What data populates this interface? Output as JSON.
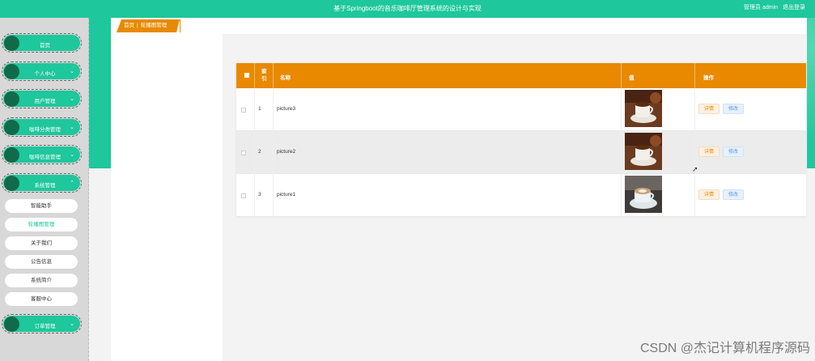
{
  "header": {
    "title": "基于Springboot的音乐咖啡厅管理系统的设计与实现",
    "role": "管理员 admin",
    "logout": "退出登录"
  },
  "sidebar": {
    "menus": [
      {
        "label": "首页",
        "expandable": false
      },
      {
        "label": "个人中心",
        "expandable": true
      },
      {
        "label": "用户管理",
        "expandable": true
      },
      {
        "label": "咖啡分类管理",
        "expandable": true
      },
      {
        "label": "咖啡信息管理",
        "expandable": true
      },
      {
        "label": "系统管理",
        "expandable": true
      },
      {
        "label": "订单管理",
        "expandable": true
      }
    ],
    "sub_items": [
      {
        "label": "智能助手"
      },
      {
        "label": "轮播图管理",
        "active": true
      },
      {
        "label": "关于我们"
      },
      {
        "label": "公告信息"
      },
      {
        "label": "系统简介"
      },
      {
        "label": "客服中心"
      }
    ]
  },
  "breadcrumb": {
    "home": "首页",
    "sep": "|",
    "current": "轮播图管理"
  },
  "table": {
    "columns": [
      "索引",
      "名称",
      "值",
      "操作"
    ],
    "rows": [
      {
        "index": "1",
        "name": "picture3",
        "image": "coffee-cup-image"
      },
      {
        "index": "2",
        "name": "picture2",
        "image": "coffee-cup-image"
      },
      {
        "index": "3",
        "name": "picture1",
        "image": "latte-cup-image"
      }
    ],
    "actions": {
      "detail": "详情",
      "edit": "修改"
    }
  },
  "watermark": "CSDN @杰记计算机程序源码",
  "colors": {
    "primary": "#1ec79c",
    "accent": "#e88900",
    "dark_dot": "#106b4a"
  }
}
